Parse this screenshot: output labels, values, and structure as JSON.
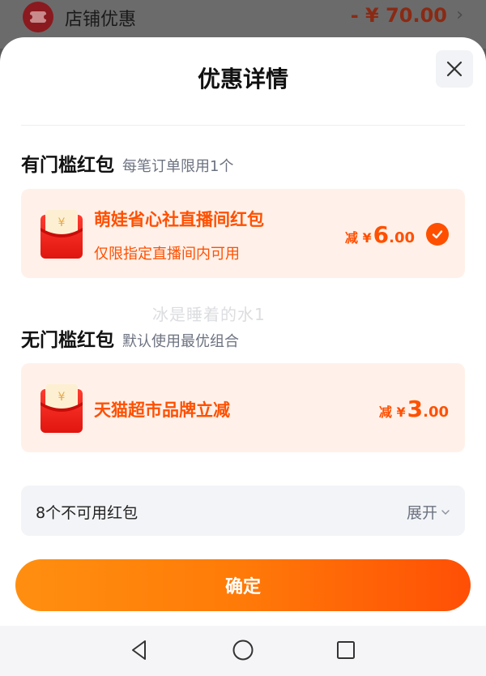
{
  "background": {
    "title": "店铺优惠",
    "amount": "- ¥ 70.00"
  },
  "sheet": {
    "title": "优惠详情"
  },
  "sections": [
    {
      "title": "有门槛红包",
      "subtitle": "每笔订单限用1个",
      "card": {
        "name": "萌娃省心社直播间红包",
        "subtitle": "仅限指定直播间内可用",
        "prefix": "减 ¥",
        "amount_int": "6",
        "amount_dec": ".00",
        "selected": true
      }
    },
    {
      "title": "无门槛红包",
      "subtitle": "默认使用最优组合",
      "card": {
        "name": "天猫超市品牌立减",
        "prefix": "减 ¥",
        "amount_int": "3",
        "amount_dec": ".00"
      }
    }
  ],
  "watermark": "冰是睡着的水1",
  "unavailable": {
    "label": "8个不可用红包",
    "expand": "展开"
  },
  "confirm_label": "确定",
  "colors": {
    "accent": "#ff5000",
    "card_bg": "#fff1ea",
    "button_start": "#ff8f10",
    "button_end": "#ff4f06"
  },
  "icons": {
    "close": "close-icon",
    "check": "check-icon",
    "envelope": "red-envelope-icon",
    "back": "nav-back-icon",
    "home": "nav-home-icon",
    "recents": "nav-recents-icon"
  }
}
